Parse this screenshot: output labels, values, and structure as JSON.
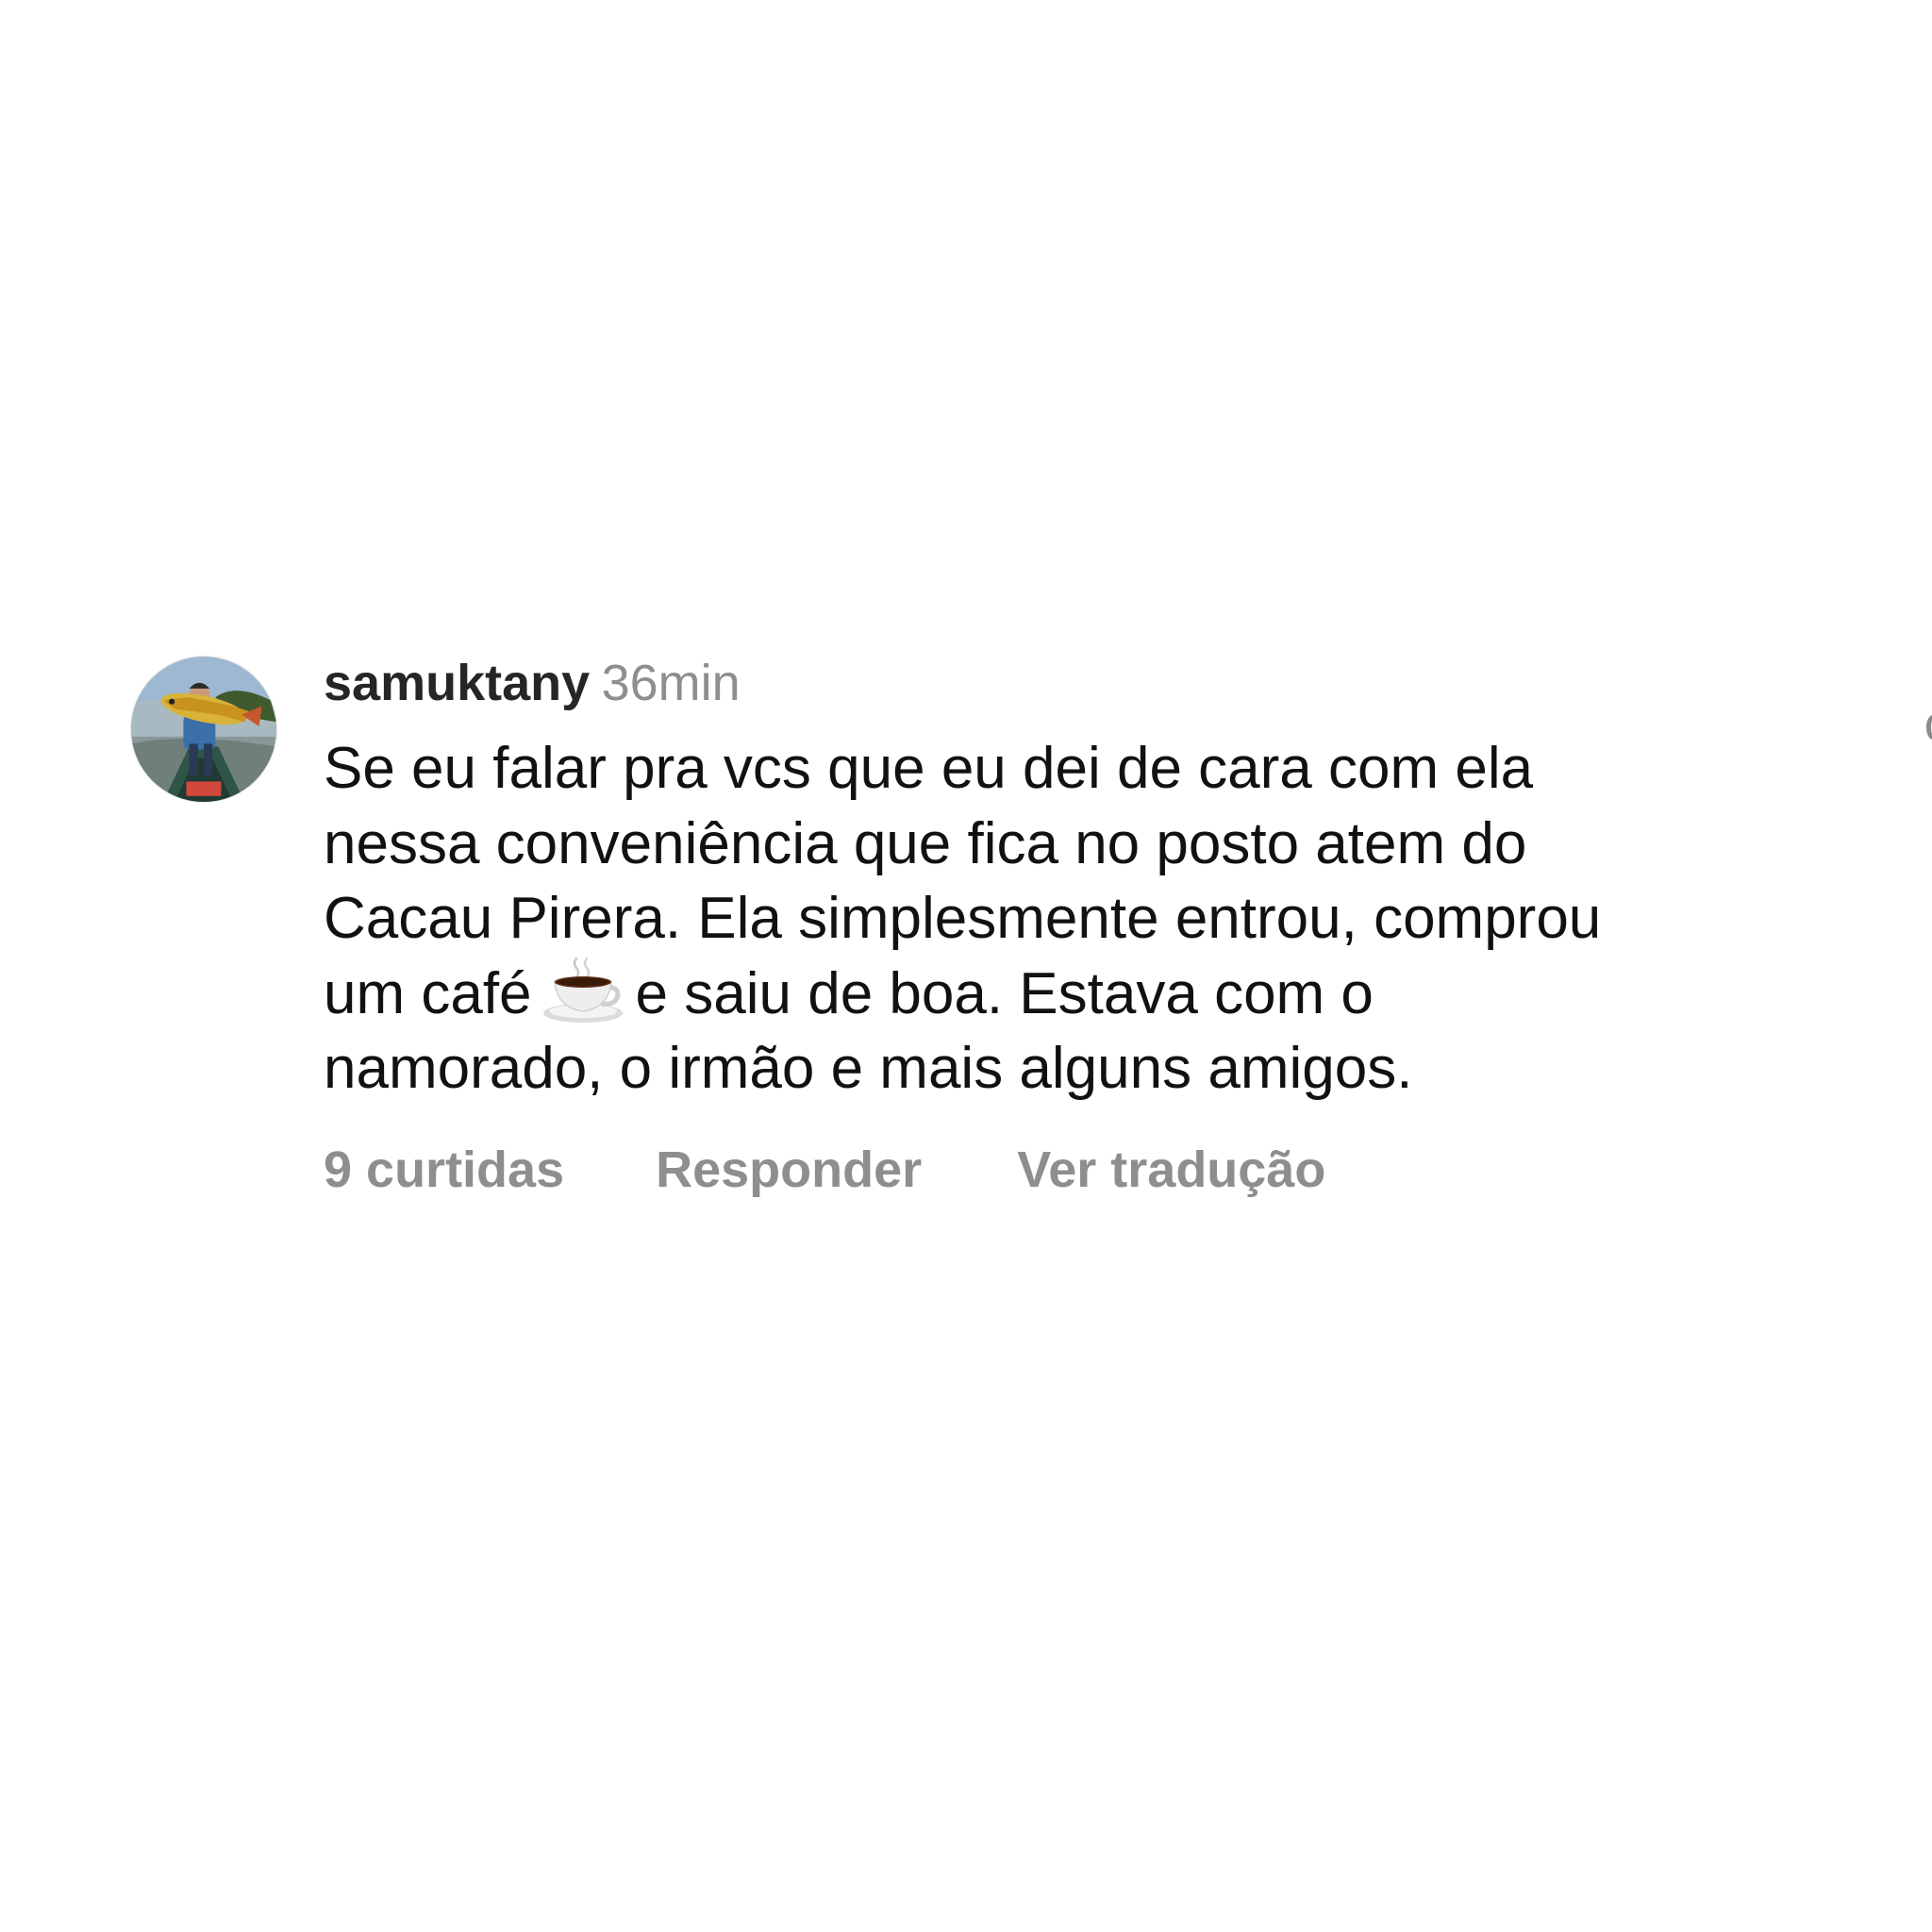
{
  "comment": {
    "username": "samuktany",
    "timestamp": "36min",
    "avatar": "profile-photo",
    "text_lines": [
      "Se eu falar pra vcs que eu dei de cara com ela",
      "nessa conveniência que fica no posto atem do",
      "Cacau Pirera. Ela simplesmente entrou, comprou"
    ],
    "line4_before_emoji": "um café",
    "emoji": "hot-beverage-icon",
    "line4_after_emoji": "e saiu de boa. Estava com o",
    "line5": "namorado, o irmão e mais alguns amigos.",
    "actions": {
      "likes": "9 curtidas",
      "reply": "Responder",
      "translate": "Ver tradução"
    }
  },
  "colors": {
    "username": "#262626",
    "body_text": "#111111",
    "secondary": "#8e8e8e",
    "background": "#ffffff"
  }
}
